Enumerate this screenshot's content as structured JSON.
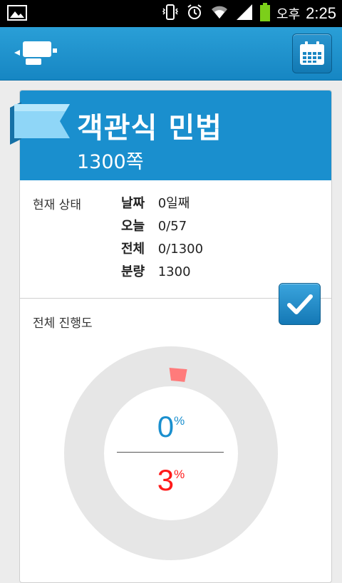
{
  "status_bar": {
    "ampm": "오후",
    "time": "2:25"
  },
  "book": {
    "title": "객관식 민법",
    "pages": "1300쪽"
  },
  "status": {
    "label": "현재 상태",
    "rows": [
      {
        "key": "날짜",
        "value": "0일째"
      },
      {
        "key": "오늘",
        "value": "0/57"
      },
      {
        "key": "전체",
        "value": "0/1300"
      },
      {
        "key": "분량",
        "value": "1300"
      }
    ]
  },
  "progress": {
    "label": "전체 진행도",
    "user_percent": "0",
    "target_percent": "3",
    "percent_sign": "%",
    "user_color": "#1a8fce",
    "target_color": "#ff1a1a",
    "target_fraction": 0.03
  },
  "colors": {
    "accent": "#1a8fce",
    "marker": "#ff7b7b"
  },
  "icons": {
    "logo": "projector-icon",
    "calendar": "calendar-icon",
    "check": "check-icon",
    "ribbon": "ribbon-icon"
  }
}
